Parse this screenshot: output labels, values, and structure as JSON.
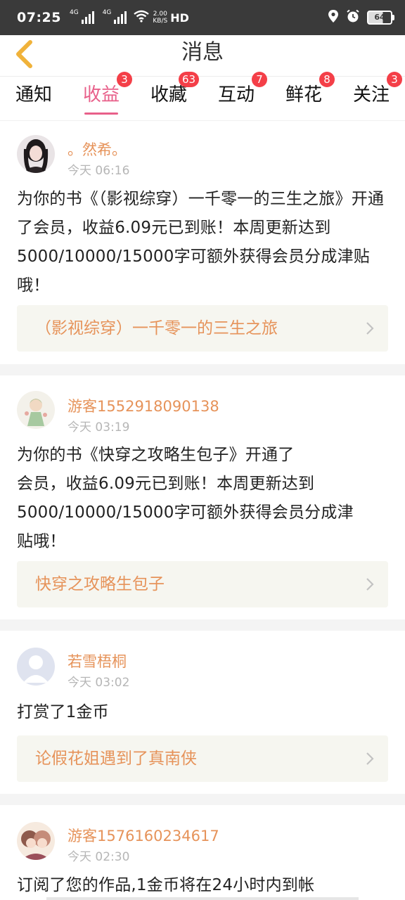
{
  "status_bar": {
    "time": "07:25",
    "net1": "4G",
    "net2": "4G",
    "speed_top": "2.00",
    "speed_bottom": "KB/S",
    "hd": "HD",
    "battery": "64"
  },
  "header": {
    "title": "消息",
    "back_icon": "chevron-left-icon"
  },
  "tabs": [
    {
      "label": "通知",
      "badge": ""
    },
    {
      "label": "收益",
      "badge": "3",
      "active": true
    },
    {
      "label": "收藏",
      "badge": "63"
    },
    {
      "label": "互动",
      "badge": "7"
    },
    {
      "label": "鲜花",
      "badge": "8"
    },
    {
      "label": "关注",
      "badge": "3"
    }
  ],
  "messages": [
    {
      "user": "。然希。",
      "time": "今天 06:16",
      "text": "为你的书《（影视综穿）一千零一的三生之旅》开通了会员，收益6.09元已到账！本周更新达到5000/10000/15000字可额外获得会员分成津贴哦！",
      "book": "（影视综穿）一千零一的三生之旅"
    },
    {
      "user": "游客1552918090138",
      "time": "今天 03:19",
      "text_lines": [
        "为你的书《快穿之攻略生包子》开通了",
        "会员，收益6.09元已到账！本周更新达到",
        "5000/10000/15000字可额外获得会员分成津",
        "贴哦！"
      ],
      "book": "快穿之攻略生包子"
    },
    {
      "user": "若雪梧桐",
      "time": "今天 03:02",
      "text": "打赏了1金币",
      "book": "论假花姐遇到了真南侠"
    },
    {
      "user": "游客1576160234617",
      "time": "今天 02:30",
      "text": "订阅了您的作品,1金币将在24小时内到帐"
    }
  ],
  "colors": {
    "accent": "#e8608a",
    "username": "#e6935a",
    "badge": "#f43f48"
  }
}
